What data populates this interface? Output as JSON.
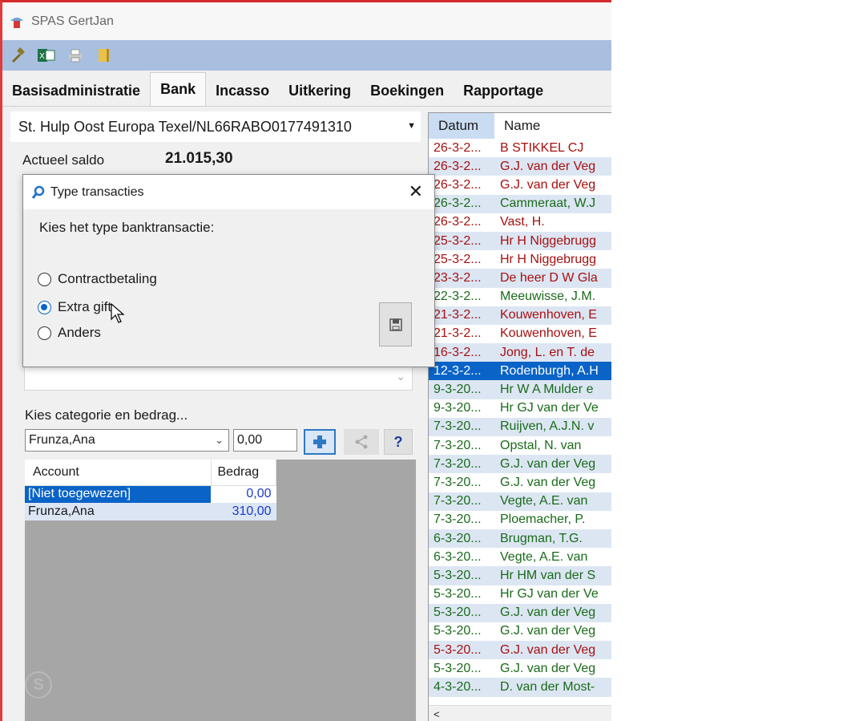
{
  "window": {
    "title": "SPAS GertJan"
  },
  "tabs": [
    {
      "label": "Basisadministratie"
    },
    {
      "label": "Bank"
    },
    {
      "label": "Incasso"
    },
    {
      "label": "Uitkering"
    },
    {
      "label": "Boekingen"
    },
    {
      "label": "Rapportage"
    }
  ],
  "account_select": {
    "value": "St. Hulp Oost Europa Texel/NL66RABO0177491310"
  },
  "saldo": {
    "label": "Actueel saldo",
    "value": "21.015,30"
  },
  "category": {
    "label": "Kies categorie en bedrag...",
    "selected": "Frunza,Ana",
    "amount": "0,00",
    "help_label": "?"
  },
  "allocation": {
    "headers": {
      "account": "Account",
      "amount": "Bedrag"
    },
    "rows": [
      {
        "account": "[Niet toegewezen]",
        "amount": "0,00"
      },
      {
        "account": "Frunza,Ana",
        "amount": "310,00"
      }
    ]
  },
  "dialog": {
    "title": "Type transacties",
    "prompt": "Kies het type banktransactie:",
    "options": [
      {
        "label": "Contractbetaling",
        "selected": false
      },
      {
        "label": "Extra gift",
        "selected": true
      },
      {
        "label": "Anders",
        "selected": false
      }
    ]
  },
  "transactions": {
    "headers": {
      "date": "Datum",
      "name": "Name"
    },
    "rows": [
      {
        "date": "26-3-2...",
        "name": "B STIKKEL CJ",
        "color": "red"
      },
      {
        "date": "26-3-2...",
        "name": "G.J. van der Veg",
        "color": "red"
      },
      {
        "date": "26-3-2...",
        "name": "G.J. van der Veg",
        "color": "red"
      },
      {
        "date": "26-3-2...",
        "name": "Cammeraat, W.J",
        "color": "green"
      },
      {
        "date": "26-3-2...",
        "name": "Vast, H.",
        "color": "red"
      },
      {
        "date": "25-3-2...",
        "name": "Hr H Niggebrugg",
        "color": "red"
      },
      {
        "date": "25-3-2...",
        "name": "Hr H Niggebrugg",
        "color": "red"
      },
      {
        "date": "23-3-2...",
        "name": "De heer D W Gla",
        "color": "red"
      },
      {
        "date": "22-3-2...",
        "name": "Meeuwisse, J.M.",
        "color": "green"
      },
      {
        "date": "21-3-2...",
        "name": "Kouwenhoven, E",
        "color": "red"
      },
      {
        "date": "21-3-2...",
        "name": "Kouwenhoven, E",
        "color": "red"
      },
      {
        "date": "16-3-2...",
        "name": "Jong, L. en T. de",
        "color": "red"
      },
      {
        "date": "12-3-2...",
        "name": "Rodenburgh, A.H",
        "color": "selected"
      },
      {
        "date": "9-3-20...",
        "name": "Hr W A Mulder e",
        "color": "green"
      },
      {
        "date": "9-3-20...",
        "name": "Hr GJ van der Ve",
        "color": "green"
      },
      {
        "date": "7-3-20...",
        "name": "Ruijven, A.J.N. v",
        "color": "green"
      },
      {
        "date": "7-3-20...",
        "name": "Opstal, N. van",
        "color": "green"
      },
      {
        "date": "7-3-20...",
        "name": "G.J. van der Veg",
        "color": "green"
      },
      {
        "date": "7-3-20...",
        "name": "G.J. van der Veg",
        "color": "green"
      },
      {
        "date": "7-3-20...",
        "name": "Vegte, A.E. van",
        "color": "green"
      },
      {
        "date": "7-3-20...",
        "name": "Ploemacher, P.",
        "color": "green"
      },
      {
        "date": "6-3-20...",
        "name": "Brugman, T.G.",
        "color": "green"
      },
      {
        "date": "6-3-20...",
        "name": "Vegte, A.E. van",
        "color": "green"
      },
      {
        "date": "5-3-20...",
        "name": "Hr HM van der S",
        "color": "green"
      },
      {
        "date": "5-3-20...",
        "name": "Hr GJ van der Ve",
        "color": "green"
      },
      {
        "date": "5-3-20...",
        "name": "G.J. van der Veg",
        "color": "green"
      },
      {
        "date": "5-3-20...",
        "name": "G.J. van der Veg",
        "color": "green"
      },
      {
        "date": "5-3-20...",
        "name": "G.J. van der Veg",
        "color": "red"
      },
      {
        "date": "5-3-20...",
        "name": "G.J. van der Veg",
        "color": "green"
      },
      {
        "date": "4-3-20...",
        "name": "D. van der Most-",
        "color": "green"
      }
    ]
  },
  "colors": {
    "selection": "#0a63c7",
    "toolbar": "#a9bfe0",
    "red_text": "#a81010",
    "green_text": "#1a6b1a"
  }
}
